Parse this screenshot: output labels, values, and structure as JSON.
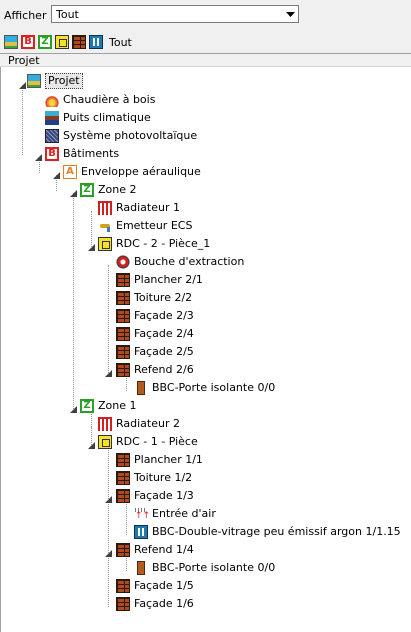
{
  "toolbar": {
    "afficher_label": "Afficher",
    "afficher_value": "Tout",
    "tout_label": "Tout",
    "filters": [
      "project-icon",
      "batiment-icon",
      "zone-icon",
      "piece-icon",
      "paroi-icon",
      "vitrage-icon"
    ]
  },
  "panel": {
    "header": "Projet"
  },
  "tree": {
    "projet": "Projet",
    "chaudiere": "Chaudière à bois",
    "puits": "Puits climatique",
    "pv": "Système photovoltaïque",
    "batiments": "Bâtiments",
    "enveloppe": "Enveloppe aéraulique",
    "zone2": "Zone 2",
    "radiateur1": "Radiateur 1",
    "emetteur": "Emetteur ECS",
    "rdc2": "RDC - 2 - Pièce_1",
    "bouche": "Bouche d'extraction",
    "plancher21": "Plancher 2/1",
    "toiture22": "Toiture 2/2",
    "facade23": "Façade 2/3",
    "facade24": "Façade 2/4",
    "facade25": "Façade 2/5",
    "refend26": "Refend 2/6",
    "porte2": "BBC-Porte isolante 0/0",
    "zone1": "Zone 1",
    "radiateur2": "Radiateur 2",
    "rdc1": "RDC - 1 - Pièce",
    "plancher11": "Plancher 1/1",
    "toiture12": "Toiture 1/2",
    "facade13": "Façade 1/3",
    "entree": "Entrée d'air",
    "vitrage": "BBC-Double-vitrage peu émissif argon 1/1.15",
    "refend14": "Refend 1/4",
    "porte1": "BBC-Porte isolante 0/0",
    "facade15": "Façade 1/5",
    "facade16": "Façade 1/6"
  },
  "colors": {
    "zone_green": "#2aa02a",
    "batiment_red": "#e02020",
    "brick": "#b04a1e",
    "selection_bg": "#e8e8e8"
  }
}
